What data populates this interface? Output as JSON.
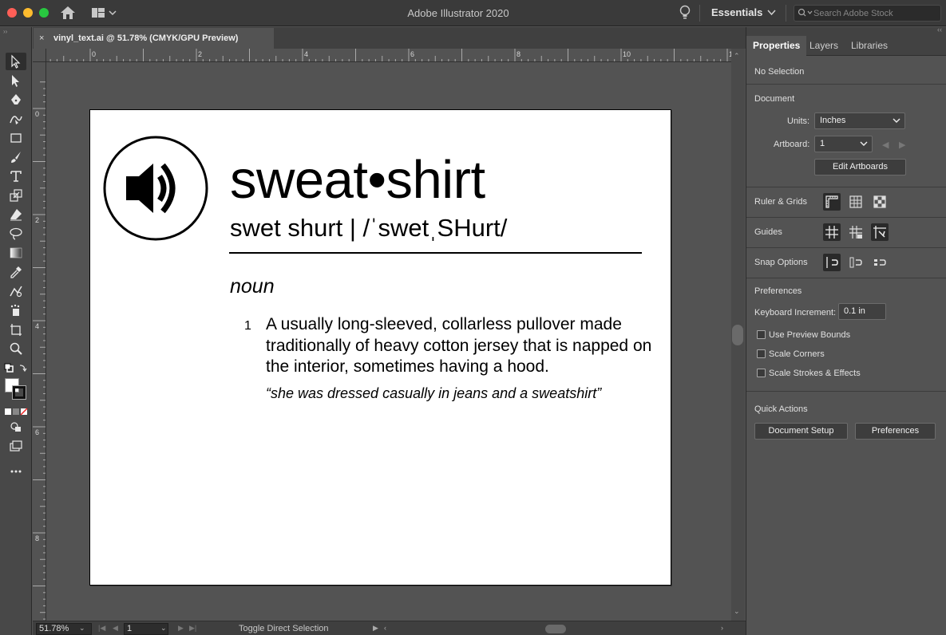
{
  "app": {
    "title": "Adobe Illustrator 2020",
    "workspace": "Essentials",
    "stock_search_placeholder": "Search Adobe Stock"
  },
  "document": {
    "tab_label": "vinyl_text.ai @ 51.78% (CMYK/GPU Preview)",
    "close_glyph": "×"
  },
  "rulers": {
    "top_labels": [
      "0",
      "2",
      "4",
      "6",
      "8",
      "10",
      "1"
    ],
    "left_labels": [
      "0",
      "2",
      "4",
      "6",
      "8"
    ]
  },
  "artboard": {
    "headword": "sweat•shirt",
    "pronunciation": "swet shurt | /ˈswetˌSHurt/",
    "part_of_speech": "noun",
    "definition_number": "1",
    "definition": "A usually long-sleeved, collarless pullover made traditionally of heavy cotton jersey that is napped on the interior, sometimes having a hood.",
    "example": "“she was dressed casually in jeans and a sweatshirt”"
  },
  "status": {
    "zoom": "51.78%",
    "artboard_number": "1",
    "tool_hint": "Toggle Direct Selection"
  },
  "panel": {
    "tabs": [
      "Properties",
      "Layers",
      "Libraries"
    ],
    "active_tab": "Properties",
    "selection_state": "No Selection",
    "document_section": "Document",
    "units_label": "Units:",
    "units_value": "Inches",
    "artboard_label": "Artboard:",
    "artboard_value": "1",
    "edit_artboards": "Edit Artboards",
    "ruler_grids": "Ruler & Grids",
    "guides": "Guides",
    "snap_options": "Snap Options",
    "preferences_section": "Preferences",
    "keyboard_increment_label": "Keyboard Increment:",
    "keyboard_increment_value": "0.1 in",
    "checkbox_preview_bounds": "Use Preview Bounds",
    "checkbox_scale_corners": "Scale Corners",
    "checkbox_scale_strokes": "Scale Strokes & Effects",
    "quick_actions": "Quick Actions",
    "document_setup": "Document Setup",
    "preferences_button": "Preferences"
  },
  "colors": {
    "ui_dark": "#3a3a3a",
    "canvas": "#535353",
    "artboard": "#ffffff"
  }
}
